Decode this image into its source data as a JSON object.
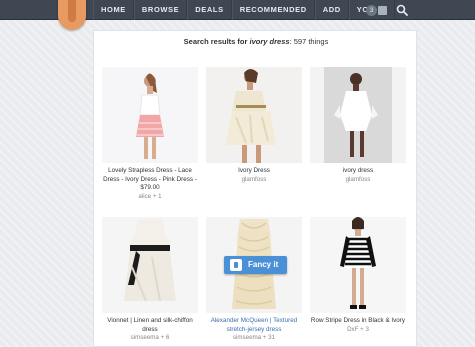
{
  "nav": {
    "items": [
      "HOME",
      "BROWSE",
      "DEALS",
      "RECOMMENDED",
      "ADD"
    ],
    "you_label": "YOU",
    "notification_count": "3"
  },
  "search": {
    "prefix": "Search results for",
    "query": "ivory dress",
    "count_text": ": 597 things"
  },
  "items": [
    {
      "caption": "Lovely Strapless Dress - Lace Dress - Ivory Dress - Pink Dress - $79.00",
      "meta": "alice + 1"
    },
    {
      "caption": "Ivory Dress",
      "meta": "glamfoss"
    },
    {
      "caption": "ivory dress",
      "meta": "glamfoss"
    },
    {
      "caption": "Vionnet | Linen and silk-chiffon dress",
      "meta": "simseema + 6"
    },
    {
      "caption": "Alexander McQueen | Textured stretch-jersey dress",
      "meta": "simseema + 31"
    },
    {
      "caption": "Row Stripe Dress in Black & Ivory",
      "meta": "DxF + 3"
    }
  ],
  "fancy_button": {
    "label": "Fancy it"
  },
  "colors": {
    "topbar": "#3f4753",
    "logo": "#e79a62",
    "fancy_blue": "#4a90d6",
    "link_blue": "#3a6fb0"
  }
}
